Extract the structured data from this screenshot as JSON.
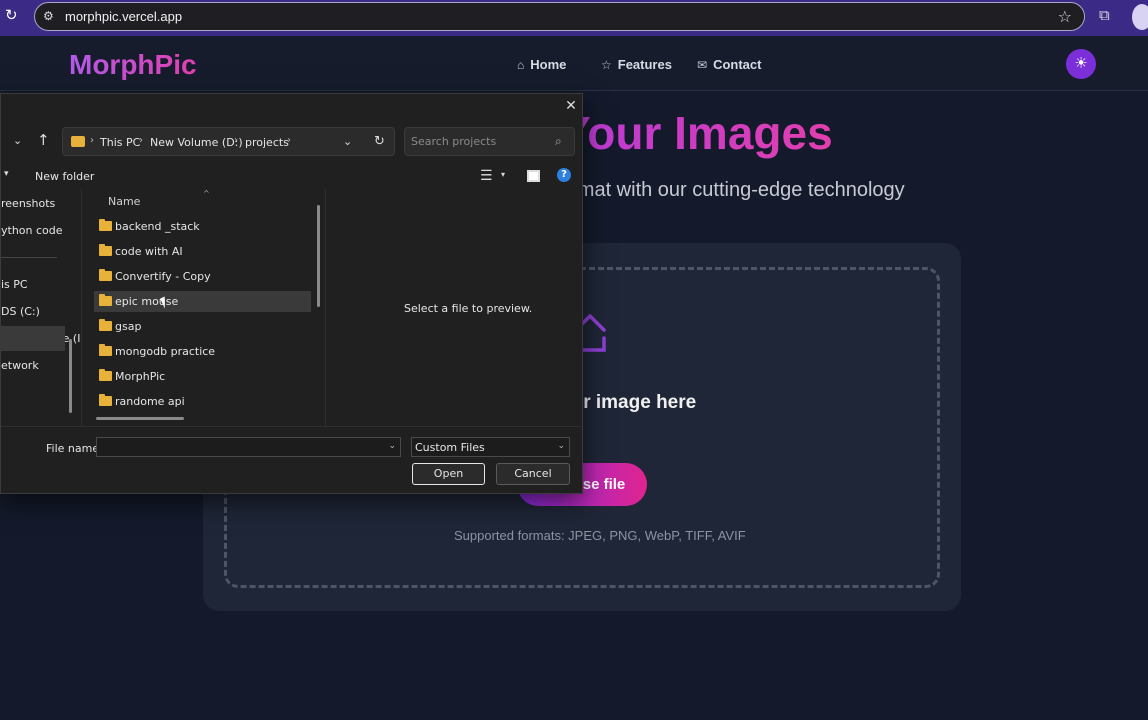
{
  "browser": {
    "url": "morphpic.vercel.app"
  },
  "site": {
    "logo": "MorphPic",
    "nav": [
      {
        "label": "Home",
        "icon": "home-icon"
      },
      {
        "label": "Features",
        "icon": "star-icon"
      },
      {
        "label": "Contact",
        "icon": "mail-icon"
      }
    ],
    "hero_title": "Your Images",
    "hero_subtitle": "ormat with our cutting-edge technology",
    "drop_title": "our image here",
    "drop_or": "r",
    "choose_button": "se file",
    "formats": "Supported formats: JPEG, PNG, WebP, TIFF, AVIF",
    "colors": {
      "accent_purple": "#7b2fd8",
      "accent_pink": "#e0248f",
      "background": "#141a2b"
    }
  },
  "dialog": {
    "breadcrumbs": [
      "This PC",
      "New Volume (D:)",
      "projects"
    ],
    "search_placeholder": "Search projects",
    "new_folder": "New folder",
    "left_nav": [
      "reenshots",
      "ython code",
      "is PC",
      "DS (C:)",
      "New Volume (I",
      "etwork"
    ],
    "column_name": "Name",
    "files": [
      "backend _stack",
      "code with AI",
      "Convertify - Copy",
      "epic mouse",
      "gsap",
      "mongodb practice",
      "MorphPic",
      "randome api"
    ],
    "hovered_file": "epic mouse",
    "preview_text": "Select a file to preview.",
    "file_name_label": "File name:",
    "file_name_value": "",
    "file_type": "Custom Files",
    "open_button": "Open",
    "cancel_button": "Cancel"
  }
}
